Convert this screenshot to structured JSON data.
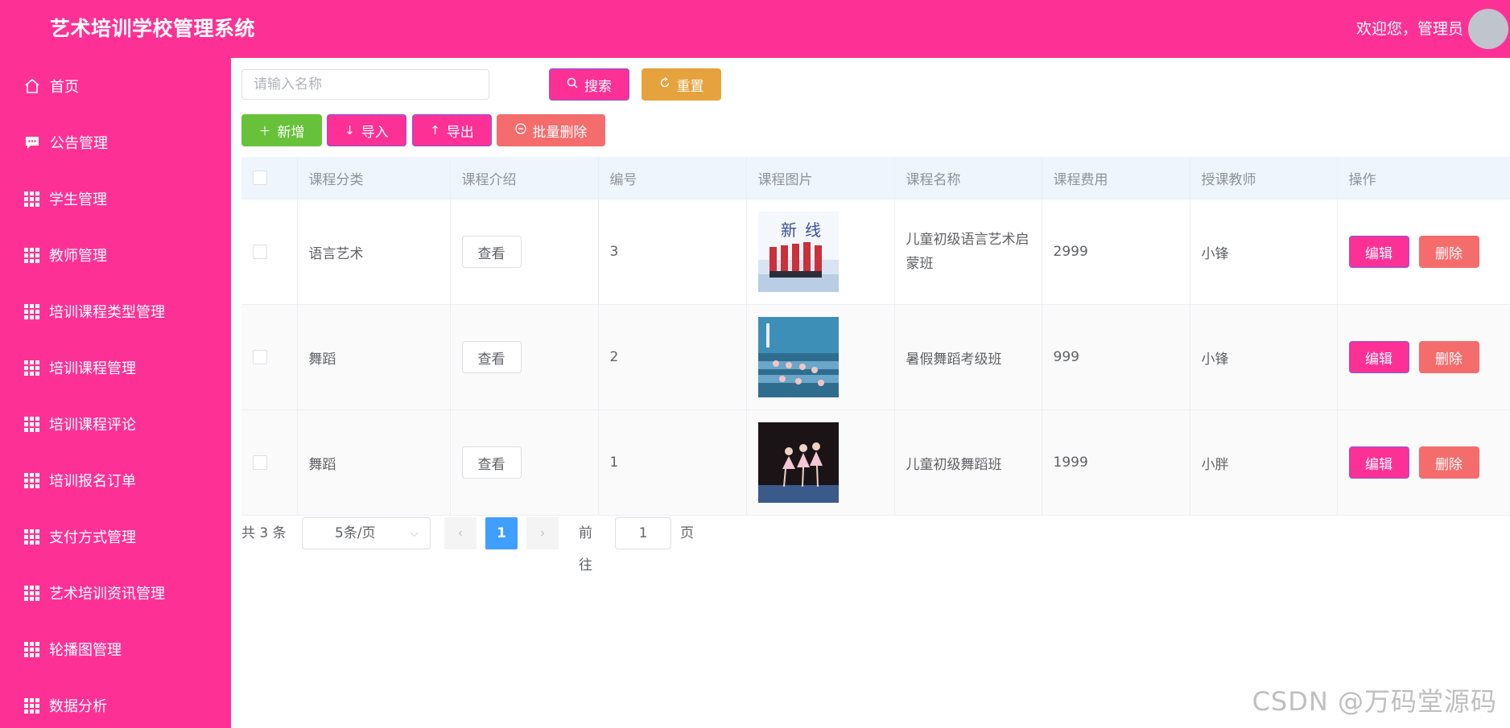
{
  "header": {
    "title": "艺术培训学校管理系统",
    "welcome": "欢迎您，管理员"
  },
  "sidebar": {
    "items": [
      {
        "label": "首页",
        "icon": "home-icon"
      },
      {
        "label": "公告管理",
        "icon": "message-icon"
      },
      {
        "label": "学生管理",
        "icon": "grid-icon"
      },
      {
        "label": "教师管理",
        "icon": "grid-icon"
      },
      {
        "label": "培训课程类型管理",
        "icon": "grid-icon"
      },
      {
        "label": "培训课程管理",
        "icon": "grid-icon"
      },
      {
        "label": "培训课程评论",
        "icon": "grid-icon"
      },
      {
        "label": "培训报名订单",
        "icon": "grid-icon"
      },
      {
        "label": "支付方式管理",
        "icon": "grid-icon"
      },
      {
        "label": "艺术培训资讯管理",
        "icon": "grid-icon"
      },
      {
        "label": "轮播图管理",
        "icon": "grid-icon"
      },
      {
        "label": "数据分析",
        "icon": "grid-icon"
      }
    ]
  },
  "search": {
    "placeholder": "请输入名称",
    "value": "",
    "search_label": "搜索",
    "reset_label": "重置"
  },
  "toolbar": {
    "add_label": "新增",
    "import_label": "导入",
    "export_label": "导出",
    "batch_delete_label": "批量删除"
  },
  "table": {
    "columns": [
      "课程分类",
      "课程介绍",
      "编号",
      "课程图片",
      "课程名称",
      "课程费用",
      "授课教师",
      "操作"
    ],
    "rows": [
      {
        "category": "语言艺术",
        "intro": "查看",
        "id": "3",
        "image": "children-stage-photo",
        "name": "儿童初级语言艺术启蒙班",
        "fee": "2999",
        "teacher": "小锋",
        "edit": "编辑",
        "delete": "删除"
      },
      {
        "category": "舞蹈",
        "intro": "查看",
        "id": "2",
        "image": "dance-class-photo",
        "name": "暑假舞蹈考级班",
        "fee": "999",
        "teacher": "小锋",
        "edit": "编辑",
        "delete": "删除"
      },
      {
        "category": "舞蹈",
        "intro": "查看",
        "id": "1",
        "image": "ballet-stage-photo",
        "name": "儿童初级舞蹈班",
        "fee": "1999",
        "teacher": "小胖",
        "edit": "编辑",
        "delete": "删除"
      }
    ]
  },
  "pagination": {
    "total_text": "共 3 条",
    "page_size": "5条/页",
    "current_page": "1",
    "goto_label": "前往",
    "goto_value": "1",
    "page_unit": "页"
  },
  "watermark": "CSDN @万码堂源码",
  "colors": {
    "primary": "#fd3195",
    "warning": "#e6a23c",
    "success": "#67c23a",
    "danger": "#f56c6c",
    "page_active": "#409eff"
  }
}
